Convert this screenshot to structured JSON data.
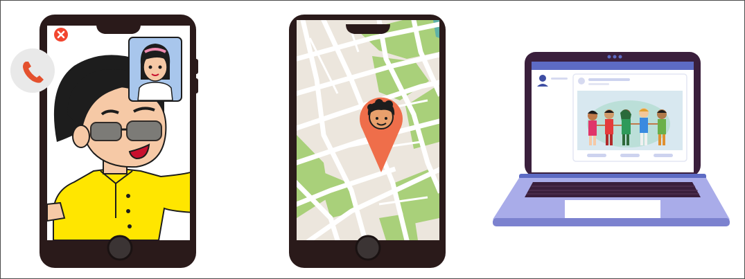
{
  "scene": {
    "phone_video_call": {
      "device": "smartphone",
      "content": "video-call",
      "controls": {
        "end_call_icon": "close-icon",
        "call_icon": "phone-icon"
      },
      "colors": {
        "frame": "#2a1a1a",
        "close": "#f2462f",
        "call": "#e4512e",
        "jacket": "#ffe600",
        "pip_bg": "#a8c6ec"
      }
    },
    "phone_map": {
      "device": "smartphone",
      "content": "map",
      "marker_icon": "location-pin-icon",
      "colors": {
        "frame": "#2a1a1a",
        "map_bg": "#ece6dd",
        "park": "#a9d07a",
        "pin": "#ef6e4a"
      }
    },
    "laptop_social": {
      "device": "laptop",
      "content": "social-feed",
      "post_icon": "user-icon",
      "colors": {
        "body": "#a9ace9",
        "screen_frame": "#3a1f3c",
        "header": "#5d6bc4",
        "accent": "#cdd3ef"
      }
    }
  }
}
